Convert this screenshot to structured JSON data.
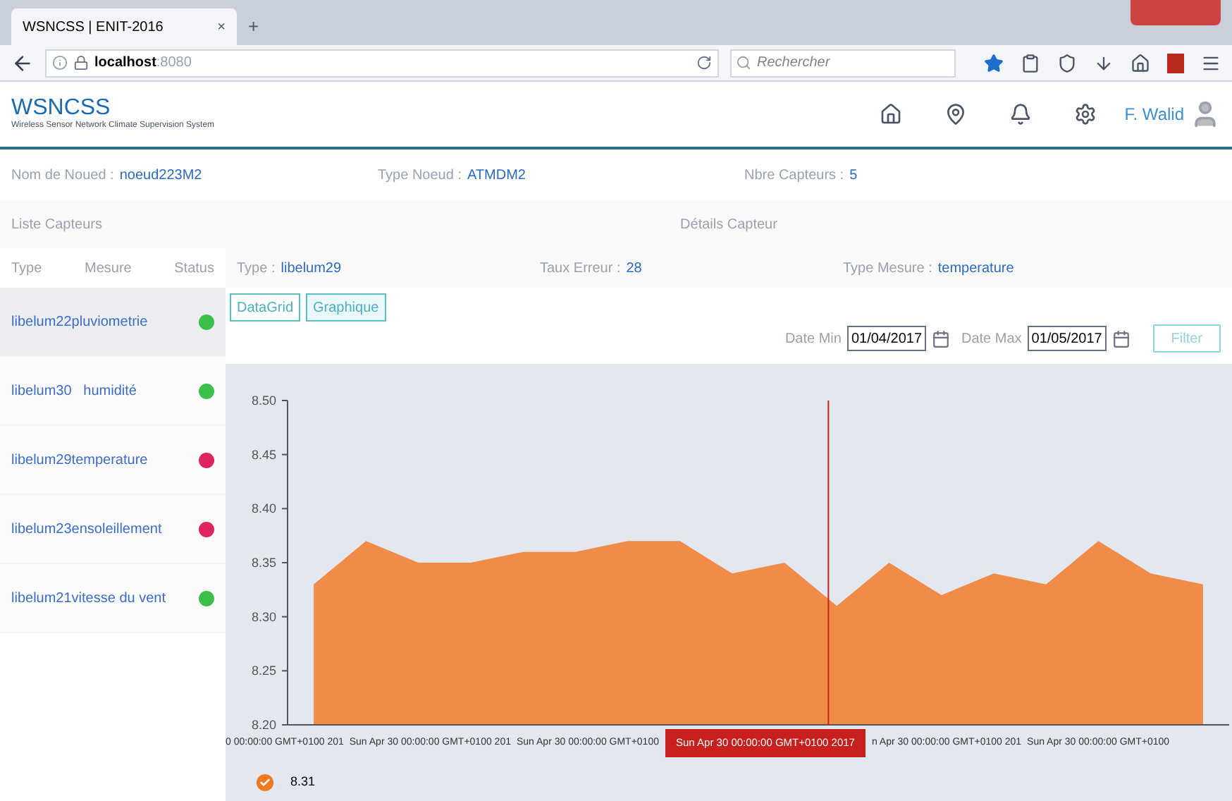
{
  "browser": {
    "tab": {
      "title": "WSNCSS | ENIT-2016",
      "close": "×",
      "new_tab": "+"
    },
    "address": {
      "host": "localhost",
      "port": ":8080"
    },
    "search": {
      "placeholder": "Rechercher"
    }
  },
  "header": {
    "brand": "WSNCSS",
    "subtitle": "Wireless Sensor Network Climate Supervision System",
    "user": "F. Walid"
  },
  "node": [
    {
      "label": "Nom de Noued :",
      "value": "noeud223M2"
    },
    {
      "label": "Type Noeud :",
      "value": "ATMDM2"
    },
    {
      "label": "Nbre Capteurs :",
      "value": "5"
    }
  ],
  "sensor_list": {
    "title": "Liste Capteurs",
    "columns": [
      "Type",
      "Mesure",
      "Status"
    ],
    "rows": [
      {
        "name": "libelum22pluviometrie",
        "color": "#3cc04a",
        "selected": true
      },
      {
        "name": "libelum30   humidité",
        "color": "#3cc04a",
        "selected": false
      },
      {
        "name": "libelum29temperature",
        "color": "#e0245e",
        "selected": false
      },
      {
        "name": "libelum23ensoleillement",
        "color": "#e0245e",
        "selected": false
      },
      {
        "name": "libelum21vitesse du vent",
        "color": "#3cc04a",
        "selected": false
      }
    ]
  },
  "details": {
    "title": "Détails Capteur",
    "fields": [
      {
        "label": "Type :",
        "value": "libelum29"
      },
      {
        "label": "Taux Erreur :",
        "value": "28"
      },
      {
        "label": "Type Mesure :",
        "value": "temperature"
      }
    ],
    "views": [
      {
        "label": "DataGrid",
        "selected": false
      },
      {
        "label": "Graphique",
        "selected": true
      }
    ],
    "filter": {
      "date_min_label": "Date Min",
      "date_min": "01/04/2017",
      "date_max_label": "Date Max",
      "date_max": "01/05/2017",
      "button": "Filter"
    }
  },
  "chart_data": {
    "type": "area",
    "yticks": [
      {
        "value": 8.2,
        "label": "8.20"
      },
      {
        "value": 8.25,
        "label": "8.25"
      },
      {
        "value": 8.3,
        "label": "8.30"
      },
      {
        "value": 8.35,
        "label": "8.35"
      },
      {
        "value": 8.4,
        "label": "8.40"
      },
      {
        "value": 8.45,
        "label": "8.45"
      },
      {
        "value": 8.5,
        "label": "8.50"
      }
    ],
    "ylim": [
      8.2,
      8.5
    ],
    "categories": [
      null,
      null,
      null,
      null,
      null,
      null,
      null,
      null,
      null,
      null,
      null,
      null,
      null,
      null,
      null,
      null,
      null,
      null
    ],
    "series": [
      {
        "name": "8.31",
        "color": "#f08c48",
        "values": [
          8.33,
          8.37,
          8.35,
          8.35,
          8.36,
          8.36,
          8.37,
          8.37,
          8.34,
          8.35,
          8.31,
          8.35,
          8.32,
          8.34,
          8.33,
          8.37,
          8.34,
          8.33
        ]
      }
    ]
  },
  "x_labels": [
    "0 00:00:00 GMT+0100 201",
    "Sun Apr 30 00:00:00 GMT+0100 201",
    "Sun Apr 30 00:00:00 GMT+0100",
    "n Apr 30 00:00:00 GMT+0100 201",
    "Sun Apr 30 00:00:00 GMT+0100"
  ],
  "tooltip": "Sun Apr 30 00:00:00 GMT+0100 2017",
  "legend": {
    "checked": true
  }
}
